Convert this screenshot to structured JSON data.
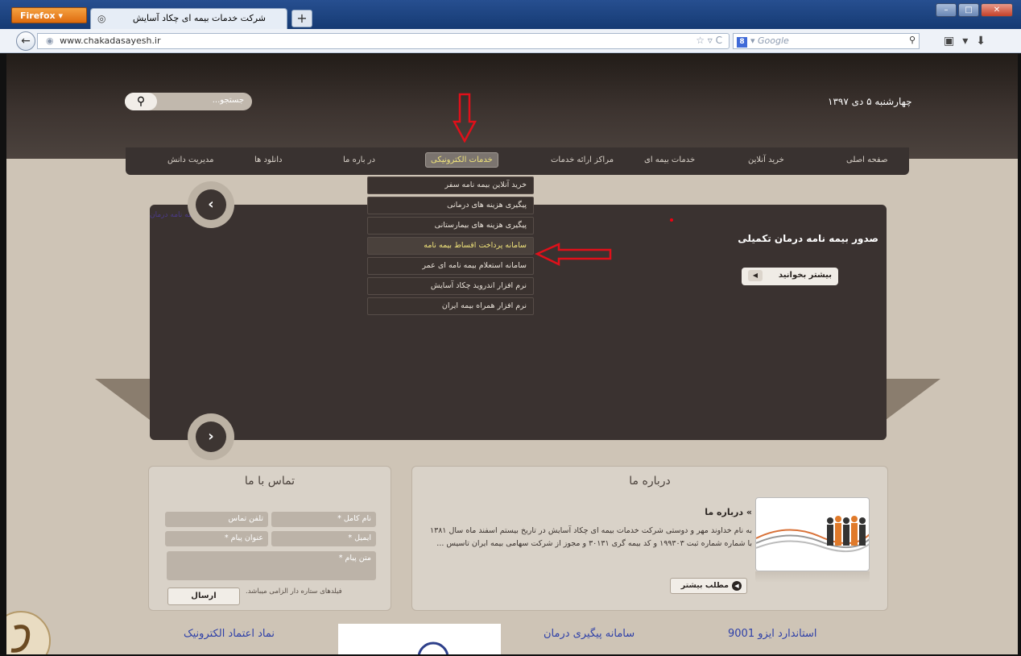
{
  "browser": {
    "app_button": "Firefox",
    "tab_title": "شرکت خدمات بیمه ای چکاد آسایش",
    "new_tab": "+",
    "url": "www.chakadasayesh.ir",
    "search_placeholder": "Google",
    "search_engine_letter": "8"
  },
  "site": {
    "date": "چهارشنبه ۵ دی ۱۳۹۷",
    "search_placeholder": "جستجو...",
    "menu": [
      {
        "label": "صفحه اصلی"
      },
      {
        "label": "خرید آنلاین"
      },
      {
        "label": "خدمات بیمه ای"
      },
      {
        "label": "مراکز ارائه خدمات"
      },
      {
        "label": "خدمات الکترونیکی"
      },
      {
        "label": "در باره ما"
      },
      {
        "label": "دانلود ها"
      },
      {
        "label": "مدیریت دانش"
      }
    ],
    "dropdown": [
      {
        "label": "خرید آنلاین بیمه نامه سفر"
      },
      {
        "label": "پیگیری هزینه های درمانی"
      },
      {
        "label": "پیگیری هزینه های بیمارستانی"
      },
      {
        "label": "سامانه پرداخت اقساط بیمه نامه"
      },
      {
        "label": "سامانه استعلام بیمه نامه ای عمر"
      },
      {
        "label": "نرم افزار اندروید چکاد آسایش"
      },
      {
        "label": "نرم افزار همراه بیمه ایران"
      }
    ],
    "slider": {
      "title": "صدور بیمه نامه درمان تکمیلی",
      "more_button": "بیشتر بخوانید",
      "tag_text": "تکمیلی - بیمه نامه درمان"
    },
    "contact": {
      "title": "تماس با ما",
      "full_name": "نام کامل *",
      "phone": "تلفن تماس",
      "email": "ایمیل *",
      "subject": "عنوان پیام *",
      "message": "متن پیام *",
      "note": "فیلدهای ستاره دار الزامی میباشد.",
      "send": "ارسال"
    },
    "about": {
      "title": "درباره ما",
      "heading": "» درباره ما",
      "text": "به نام خداوند مهر و دوستی شرکت خدمات بیمه ای چکاد آسایش در تاریخ بیستم اسفند ماه سال ۱۳۸۱ با شماره شماره ثبت ۱۹۹۳۰۳ و کد بیمه گری ۳۰۱۳۱ و مجوز از شرکت سهامی بیمه ایران تاسیس ...",
      "more": "مطلب بیشتر"
    },
    "footer": {
      "iso": "استاندارد ایزو 9001",
      "treatment": "سامانه پیگیری درمان",
      "enamad": "نماد اعتماد الکترونیک"
    }
  },
  "colors": {
    "header_dark": "#3d3430",
    "page_bg": "#cec4b6",
    "menu_active_text": "#f0e37a",
    "annotation_red": "#e0101a",
    "footer_link": "#2d3fa8"
  }
}
